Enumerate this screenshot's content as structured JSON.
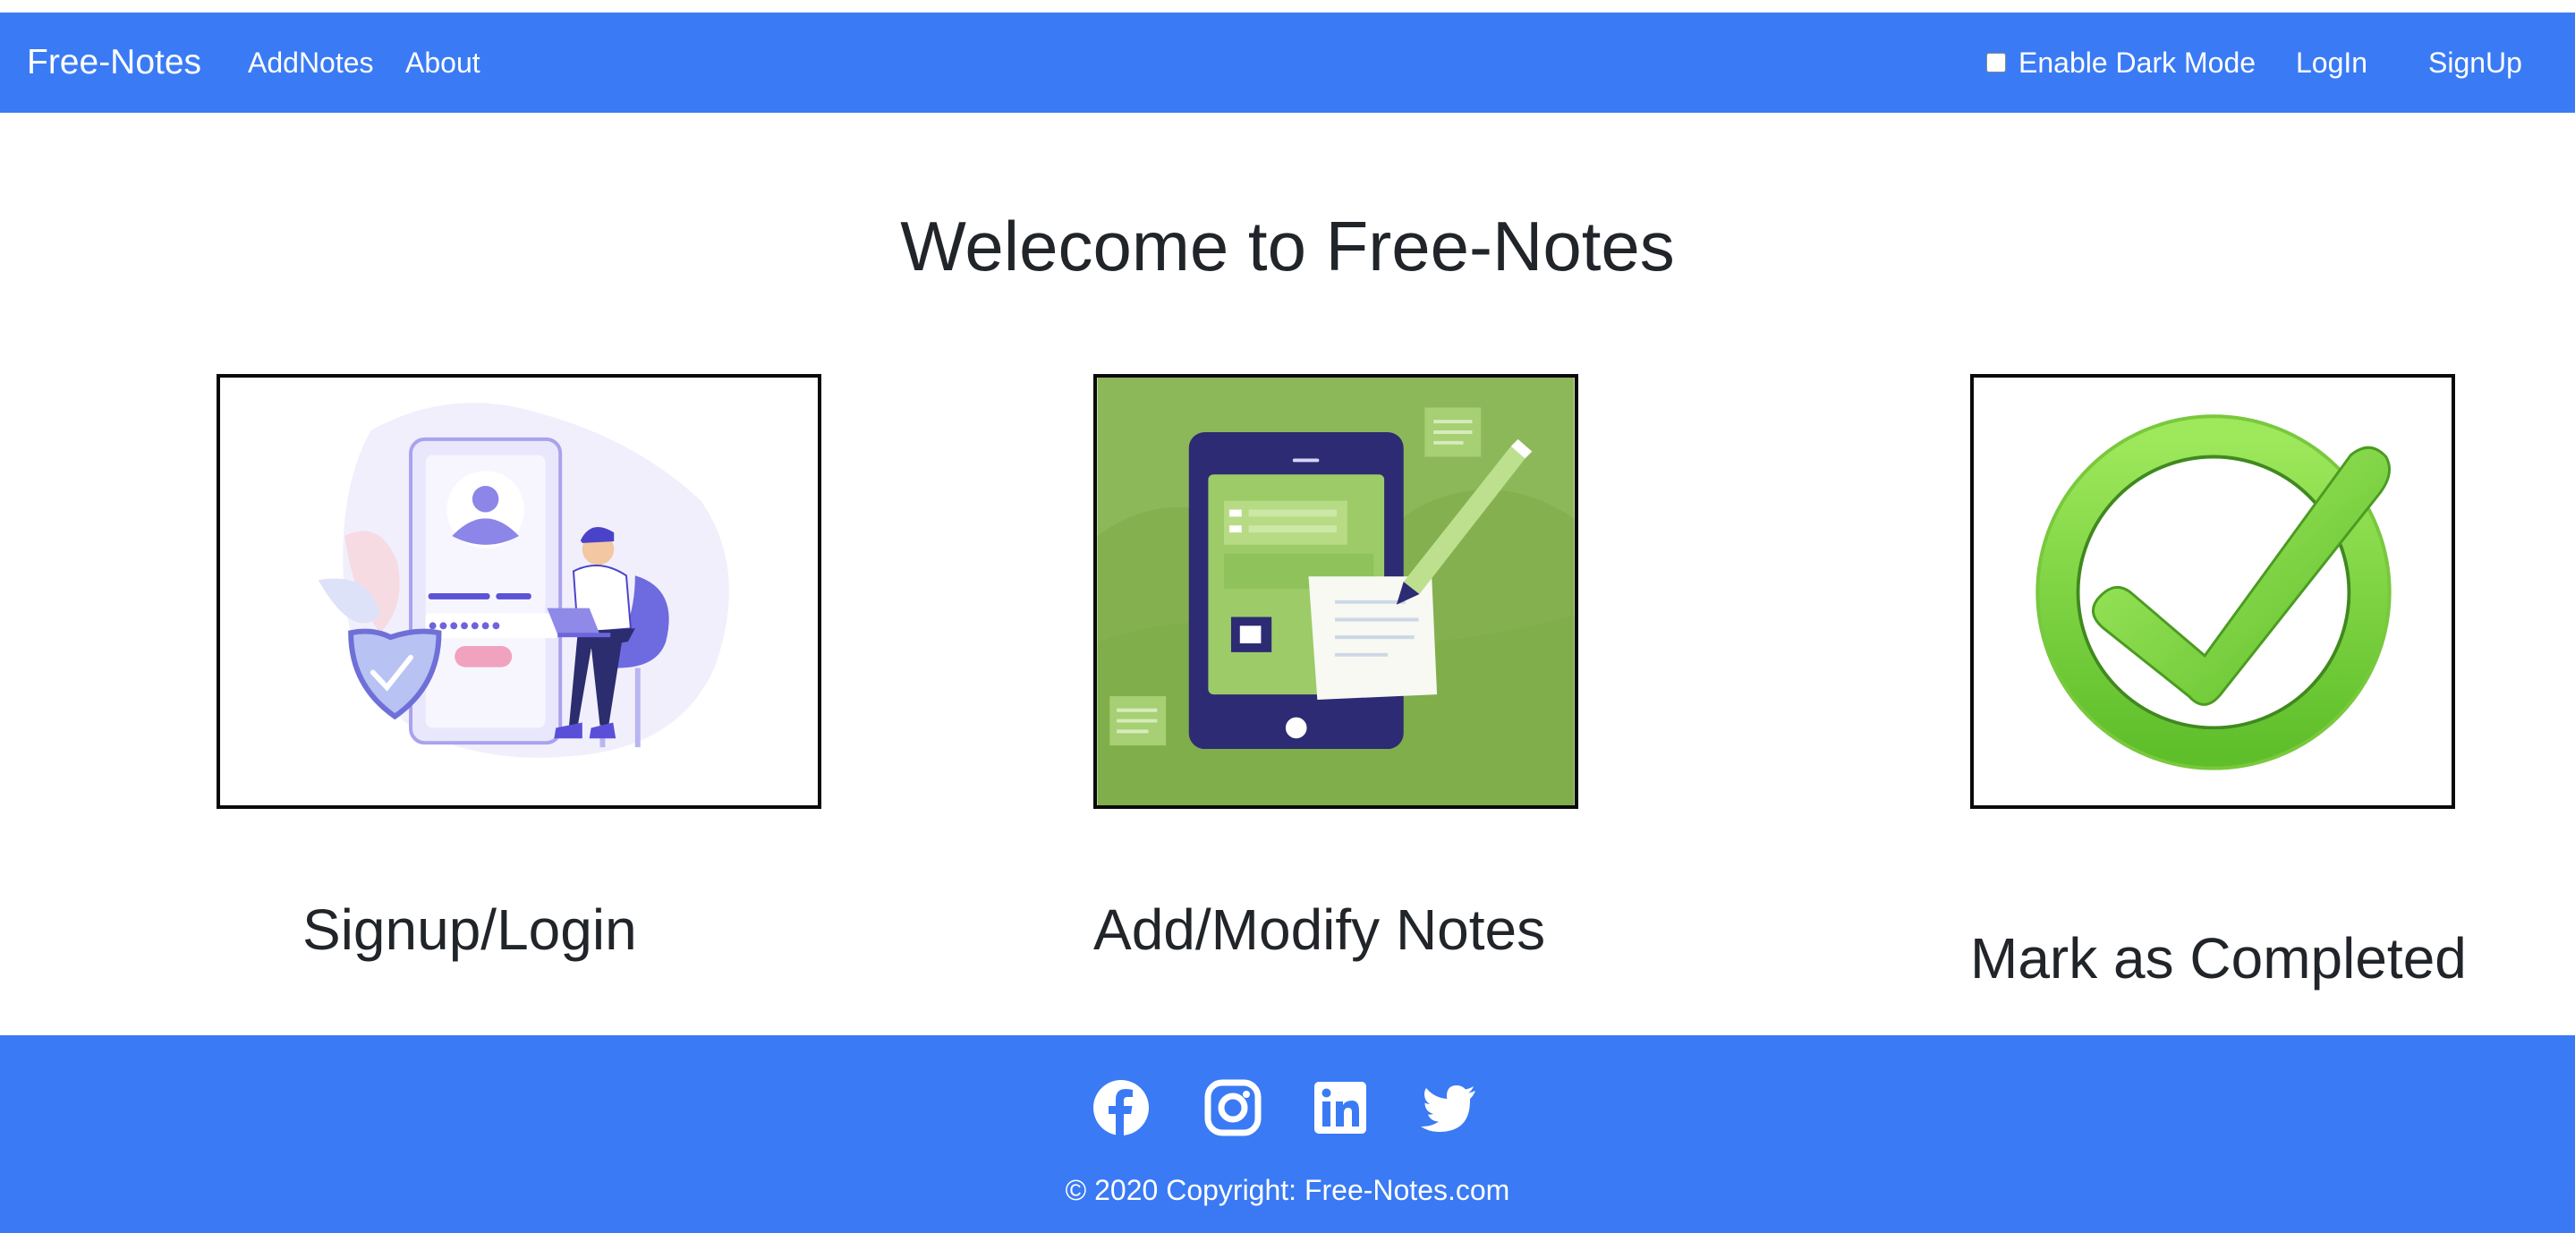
{
  "navbar": {
    "brand": "Free-Notes",
    "links": [
      "AddNotes",
      "About"
    ],
    "dark_mode_label": "Enable Dark Mode",
    "login_label": "LogIn",
    "signup_label": "SignUp",
    "bg_color": "#3a7bf5"
  },
  "main": {
    "title": "Welecome to Free-Notes",
    "cards": [
      {
        "caption": "Signup/Login",
        "icon": "signup-login-illustration"
      },
      {
        "caption": "Add/Modify Notes",
        "icon": "tablet-notes-illustration"
      },
      {
        "caption": "Mark as Completed",
        "icon": "green-checkmark-icon"
      }
    ]
  },
  "footer": {
    "social": [
      "facebook-icon",
      "instagram-icon",
      "linkedin-icon",
      "twitter-icon"
    ],
    "copyright": "© 2020 Copyright: Free-Notes.com",
    "bg_color": "#3a7bf5"
  }
}
